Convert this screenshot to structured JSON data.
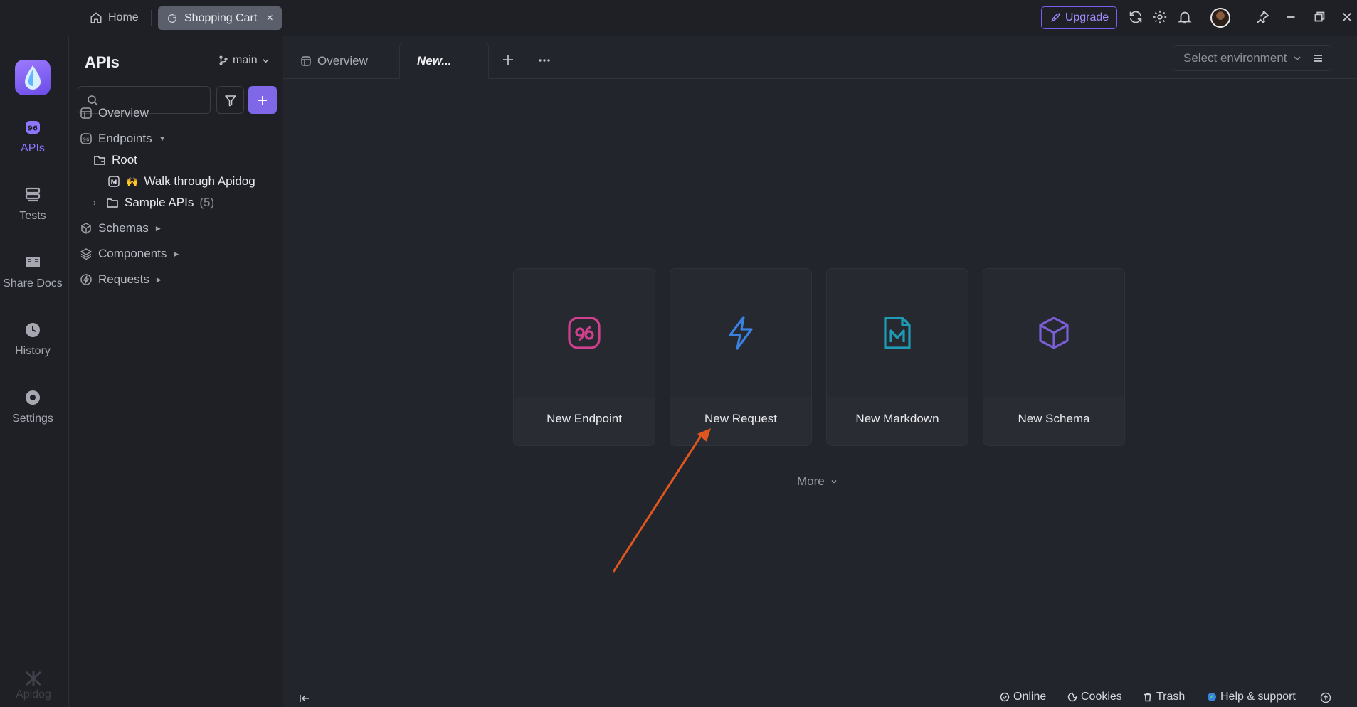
{
  "titlebar": {
    "home_tab": "Home",
    "active_tab": "Shopping Cart",
    "close_glyph": "×",
    "upgrade_label": "Upgrade",
    "accent_color": "#7b5cf0"
  },
  "rail": {
    "items": [
      {
        "label": "APIs",
        "icon": "api-icon",
        "active": true
      },
      {
        "label": "Tests",
        "icon": "tests-icon",
        "active": false
      },
      {
        "label": "Share Docs",
        "icon": "book-icon",
        "active": false
      },
      {
        "label": "History",
        "icon": "clock-icon",
        "active": false
      },
      {
        "label": "Settings",
        "icon": "gear-icon",
        "active": false
      }
    ],
    "brand": "Apidog"
  },
  "sidebar": {
    "title": "APIs",
    "branch": "main",
    "search_placeholder": "",
    "tree": [
      {
        "label": "Overview",
        "icon": "overview-icon"
      },
      {
        "label": "Endpoints",
        "icon": "api-icon"
      },
      {
        "label": "Root",
        "icon": "folder-icon"
      },
      {
        "label": "Walk through Apidog",
        "icon": "markdown-icon",
        "emoji": "🙌"
      },
      {
        "label": "Sample APIs",
        "icon": "folder-icon",
        "count": "(5)"
      },
      {
        "label": "Schemas",
        "icon": "cube-icon"
      },
      {
        "label": "Components",
        "icon": "layers-icon"
      },
      {
        "label": "Requests",
        "icon": "bolt-icon"
      }
    ]
  },
  "main": {
    "tabs": [
      {
        "label": "Overview"
      },
      {
        "label": "New..."
      }
    ],
    "env_placeholder": "Select environment",
    "cards": [
      {
        "label": "New Endpoint",
        "icon": "api-icon",
        "color": "#d0408f"
      },
      {
        "label": "New Request",
        "icon": "bolt-icon",
        "color": "#3a82e0"
      },
      {
        "label": "New Markdown",
        "icon": "markdown-icon",
        "color": "#1e9bb5"
      },
      {
        "label": "New Schema",
        "icon": "cube-icon",
        "color": "#7a5fd6"
      }
    ],
    "more_label": "More",
    "annotation_arrow_color": "#e0561f"
  },
  "statusbar": {
    "online": "Online",
    "cookies": "Cookies",
    "trash": "Trash",
    "help": "Help & support"
  }
}
